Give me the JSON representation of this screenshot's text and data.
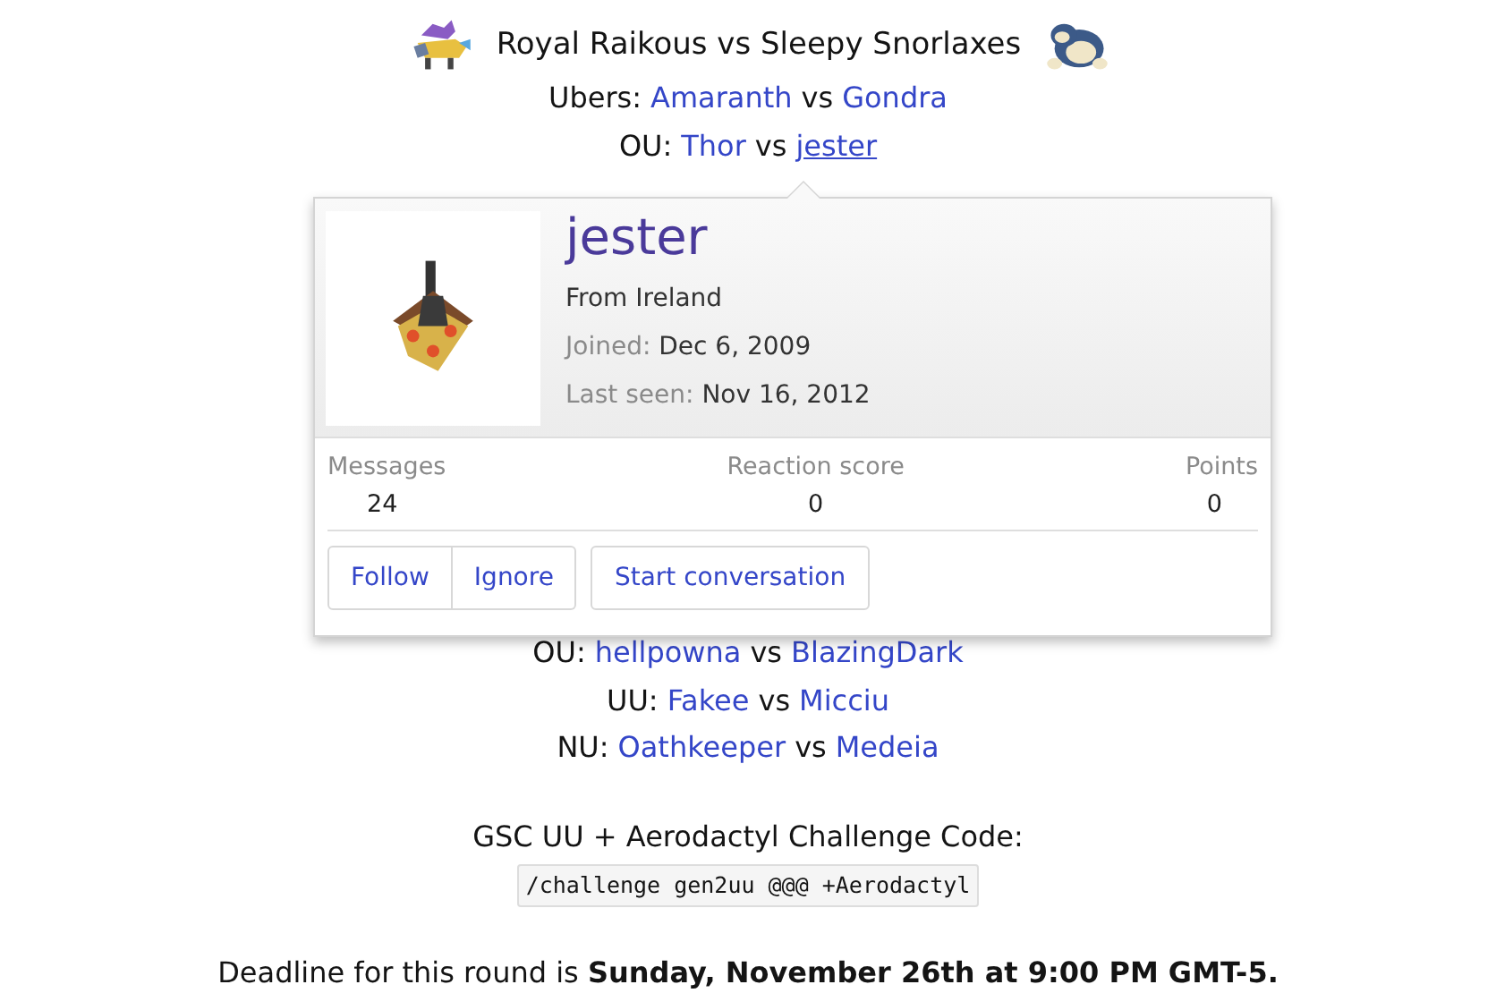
{
  "header": {
    "title": "Royal Raikous vs Sleepy Snorlaxes"
  },
  "matches_top": [
    {
      "tier": "Ubers:",
      "joiner": "vs",
      "players": [
        {
          "name": "Amaranth",
          "hovered": false
        },
        {
          "name": "Gondra",
          "hovered": false
        }
      ]
    },
    {
      "tier": "OU:",
      "joiner": "vs",
      "players": [
        {
          "name": "Thor",
          "hovered": false
        },
        {
          "name": "jester",
          "hovered": true
        }
      ]
    }
  ],
  "matches_bottom": [
    {
      "tier": "OU:",
      "joiner": "vs",
      "players": [
        {
          "name": "hellpowna",
          "hovered": false
        },
        {
          "name": "BlazingDark",
          "hovered": false
        }
      ]
    },
    {
      "tier": "UU:",
      "joiner": "vs",
      "players": [
        {
          "name": "Fakee",
          "hovered": false
        },
        {
          "name": "Micciu",
          "hovered": false
        }
      ]
    },
    {
      "tier": "NU:",
      "joiner": "vs",
      "players": [
        {
          "name": "Oathkeeper",
          "hovered": false
        },
        {
          "name": "Medeia",
          "hovered": false
        }
      ]
    }
  ],
  "challenge": {
    "label": "GSC UU + Aerodactyl Challenge Code:",
    "code": "/challenge gen2uu @@@ +Aerodactyl"
  },
  "deadline": "Deadline for this round is **Sunday, November 26th at 9:00 PM GMT-5.**",
  "member_card": {
    "username": "jester",
    "location": "From Ireland",
    "joined": {
      "label": "Joined:",
      "value": "Dec 6, 2009"
    },
    "last_seen": {
      "label": "Last seen:",
      "value": "Nov 16, 2012"
    },
    "stats": [
      {
        "label": "Messages",
        "value": "24"
      },
      {
        "label": "Reaction score",
        "value": "0"
      },
      {
        "label": "Points",
        "value": "0"
      }
    ],
    "buttons": [
      {
        "label": "Follow",
        "kind": "grouped"
      },
      {
        "label": "Ignore",
        "kind": "grouped"
      },
      {
        "label": "Start conversation",
        "kind": "single"
      }
    ]
  }
}
